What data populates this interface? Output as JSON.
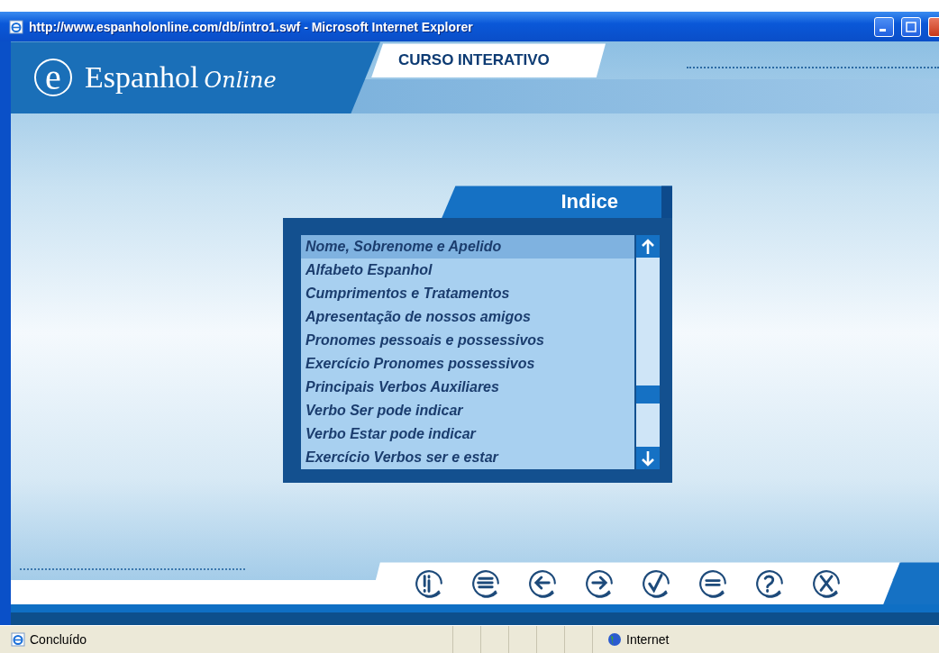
{
  "window": {
    "title": "http://www.espanholonline.com/db/intro1.swf - Microsoft Internet Explorer"
  },
  "header": {
    "logo_mark": "e",
    "logo_word": "Espanhol",
    "logo_script": "Online",
    "course_tab": "CURSO INTERATIVO"
  },
  "index": {
    "title": "Indice",
    "items": [
      {
        "label": "Nome, Sobrenome e Apelido",
        "selected": true
      },
      {
        "label": "Alfabeto Espanhol",
        "selected": false
      },
      {
        "label": "Cumprimentos e Tratamentos",
        "selected": false
      },
      {
        "label": "Apresentação de nossos amigos",
        "selected": false
      },
      {
        "label": "Pronomes pessoais e possessivos",
        "selected": false
      },
      {
        "label": "Exercício Pronomes possessivos",
        "selected": false
      },
      {
        "label": "Principais Verbos Auxiliares",
        "selected": false
      },
      {
        "label": "Verbo Ser pode indicar",
        "selected": false
      },
      {
        "label": "Verbo Estar pode indicar",
        "selected": false
      },
      {
        "label": "Exercício Verbos ser e estar",
        "selected": false
      }
    ]
  },
  "status_bar": {
    "status": "Concluído",
    "zone": "Internet"
  }
}
